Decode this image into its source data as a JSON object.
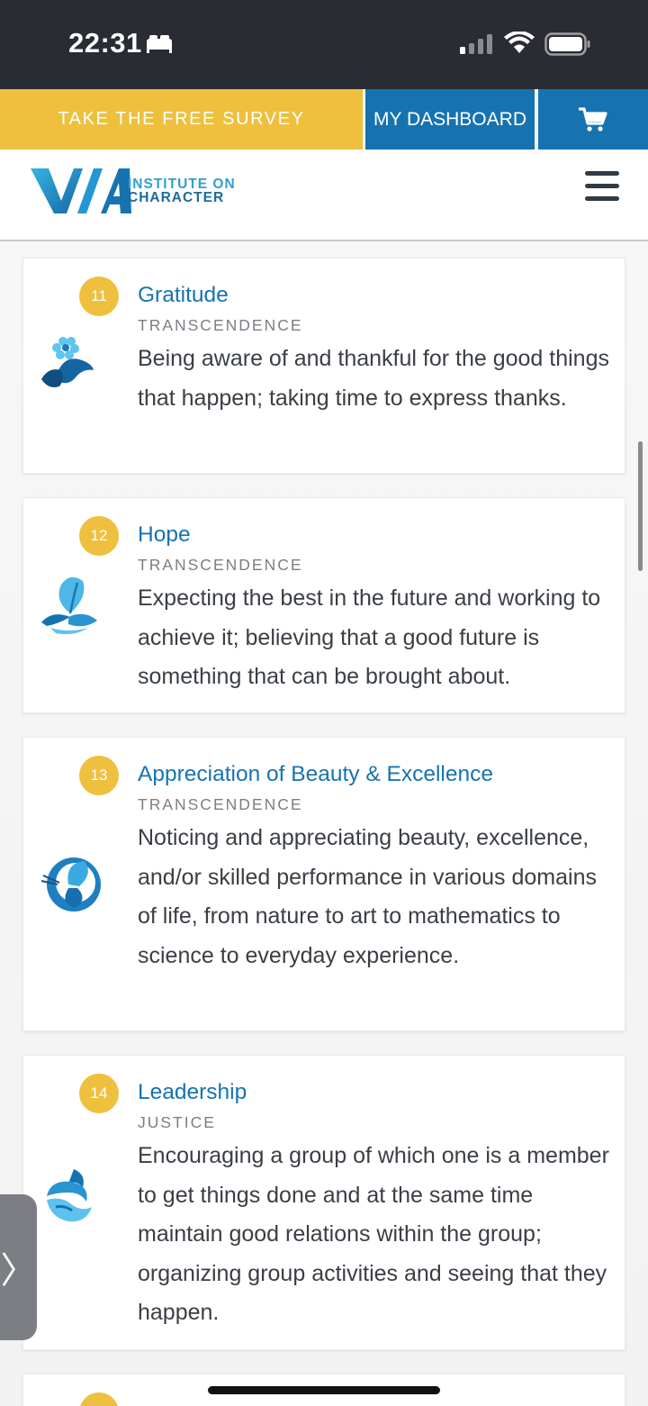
{
  "status_bar": {
    "time": "22:31",
    "icons": [
      "sleep-icon",
      "cellular-signal-icon",
      "wifi-icon",
      "battery-icon"
    ]
  },
  "topbar": {
    "survey_label": "TAKE THE FREE SURVEY",
    "dashboard_label": "MY DASHBOARD",
    "cart_icon": "cart-icon"
  },
  "header": {
    "logo_mark": "VIA",
    "logo_line1": "INSTITUTE ON",
    "logo_line2": "CHARACTER",
    "menu_icon": "hamburger-menu-icon"
  },
  "colors": {
    "brand_blue": "#1773b0",
    "survey_yellow": "#eec03e",
    "status_bar": "#2a2c33"
  },
  "strengths": [
    {
      "rank": "11",
      "title": "Gratitude",
      "category": "TRANSCENDENCE",
      "description": "Being aware of and thankful for the good things that happen; taking time to express thanks.",
      "icon": "gratitude-flower-icon"
    },
    {
      "rank": "12",
      "title": "Hope",
      "category": "TRANSCENDENCE",
      "description": "Expecting the best in the future and working to achieve it; believing that a good future is something that can be brought about.",
      "icon": "hope-leaf-icon"
    },
    {
      "rank": "13",
      "title": "Appreciation of Beauty & Excellence",
      "category": "TRANSCENDENCE",
      "description": "Noticing and appreciating beauty, excellence, and/or skilled performance in various domains of life, from nature to art to mathematics to science to everyday experience.",
      "icon": "beauty-butterfly-icon"
    },
    {
      "rank": "14",
      "title": "Leadership",
      "category": "JUSTICE",
      "description": "Encouraging a group of which one is a member to get things done and at the same time maintain good relations within the group; organizing group activities and seeing that they happen.",
      "icon": "leadership-wave-icon"
    }
  ],
  "side_tab_glyph": "〉"
}
